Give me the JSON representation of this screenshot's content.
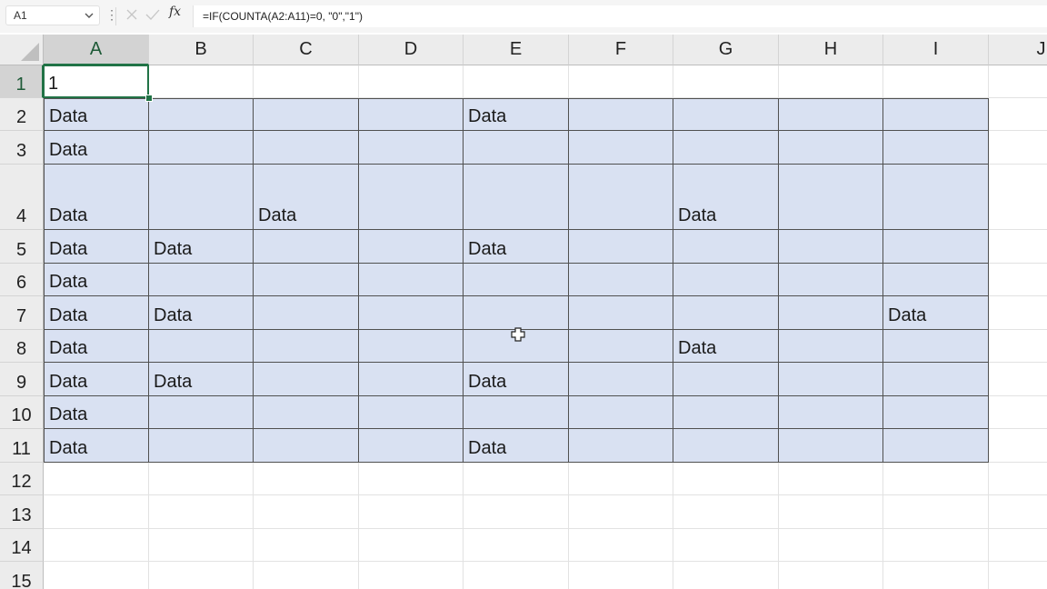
{
  "formula_bar": {
    "name_box": "A1",
    "formula": "=IF(COUNTA(A2:A11)=0, \"0\",\"1\")",
    "fx_label": "fx",
    "menu_dots": "⋮"
  },
  "columns": [
    "A",
    "B",
    "C",
    "D",
    "E",
    "F",
    "G",
    "H",
    "I",
    "J"
  ],
  "rows": [
    "1",
    "2",
    "3",
    "4",
    "5",
    "6",
    "7",
    "8",
    "9",
    "10",
    "11",
    "12",
    "13",
    "14",
    "15"
  ],
  "selected_cell": "A1",
  "cells": {
    "A1": "1",
    "A2": "Data",
    "E2": "Data",
    "A3": "Data",
    "A4": "Data",
    "C4": "Data",
    "G4": "Data",
    "A5": "Data",
    "B5": "Data",
    "E5": "Data",
    "A6": "Data",
    "A7": "Data",
    "B7": "Data",
    "I7": "Data",
    "A8": "Data",
    "G8": "Data",
    "A9": "Data",
    "B9": "Data",
    "E9": "Data",
    "A10": "Data",
    "A11": "Data",
    "E11": "Data"
  },
  "filled_range": "A2:I11",
  "colors": {
    "fill": "#d9e1f2",
    "selection": "#217346"
  }
}
